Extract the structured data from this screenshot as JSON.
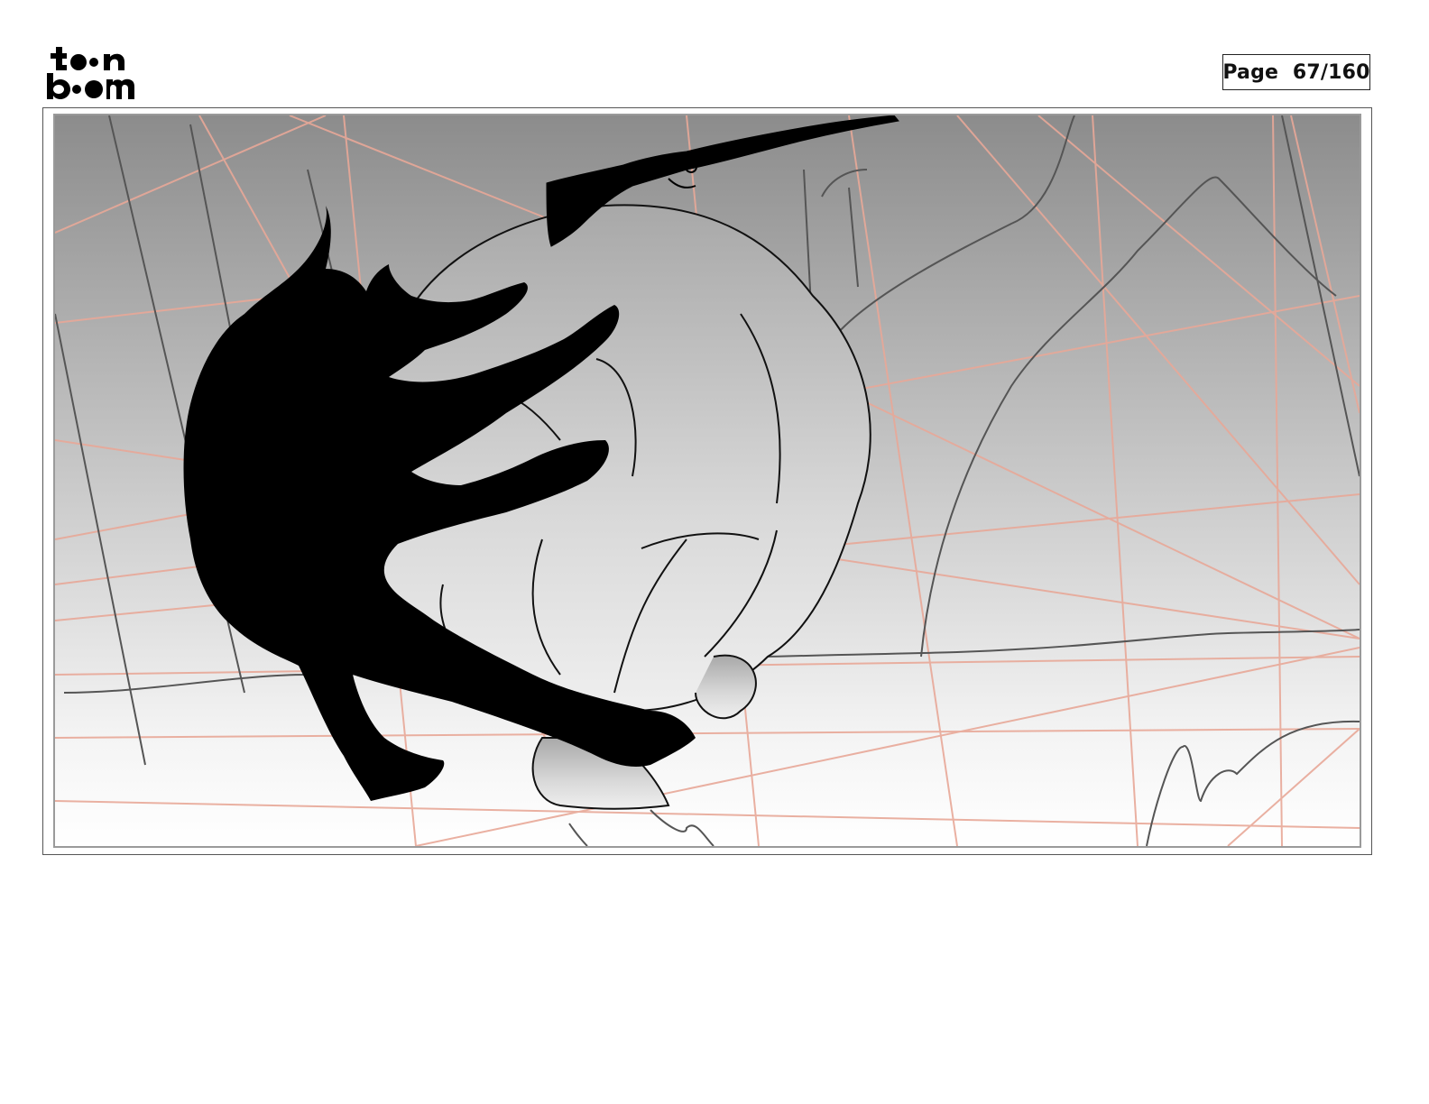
{
  "header": {
    "logo_text_top": "toon",
    "logo_text_bottom": "boom",
    "page_counter": "Page  67/160"
  },
  "panel": {
    "colors": {
      "sky_top": "#8c8c8c",
      "sky_bottom": "#ffffff",
      "guide_lines": "#e8a898",
      "sketch_lines": "#555555",
      "silhouette": "#000000",
      "creature_fill": "#d6d6d6"
    }
  }
}
